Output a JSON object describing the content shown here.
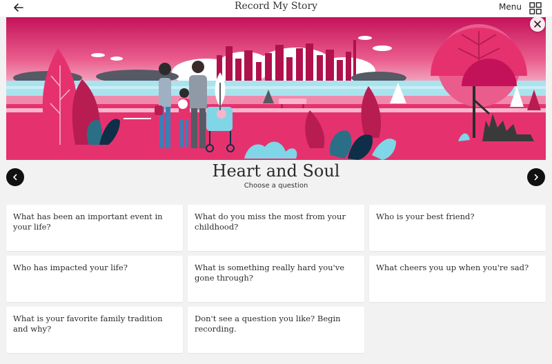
{
  "header": {
    "title": "Record My Story",
    "menu_label": "Menu"
  },
  "category": {
    "title": "Heart and Soul",
    "subtitle": "Choose a question"
  },
  "questions": [
    "What has been an important event in your life?",
    "What do you miss the most from your childhood?",
    "Who is your best friend?",
    "Who has impacted your life?",
    "What is something really hard you've gone through?",
    "What cheers you up when you're sad?",
    "What is your favorite family tradition and why?",
    "Don't see a question you like? Begin recording."
  ],
  "icons": {
    "back": "arrow-left-icon",
    "grid": "grid-icon",
    "close": "close-icon",
    "prev": "chevron-left-icon",
    "next": "chevron-right-icon"
  },
  "colors": {
    "magenta": "#e5326e",
    "dark_pink": "#b81d52",
    "cyan": "#7fd6e6",
    "teal": "#2a6f86",
    "navy": "#0e2f47",
    "sky_top": "#c4125a",
    "sky_bottom": "#f6c2d3",
    "card_bg": "#ffffff",
    "page_bg": "#f2f2f2"
  }
}
